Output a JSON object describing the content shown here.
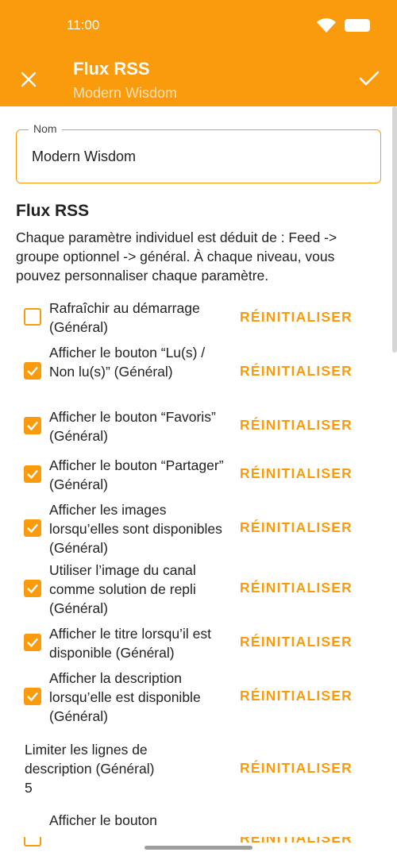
{
  "status": {
    "time": "11:00"
  },
  "header": {
    "title": "Flux RSS",
    "subtitle": "Modern Wisdom"
  },
  "name_field": {
    "label": "Nom",
    "value": "Modern Wisdom"
  },
  "section": {
    "title": "Flux RSS",
    "description": "Chaque paramètre individuel est déduit de : Feed -> groupe optionnel -> général. À chaque niveau, vous pouvez personnaliser chaque paramètre."
  },
  "settings": [
    {
      "label": "Rafraîchir au démarrage (Général)",
      "checked": false,
      "reset": "RÉINITIALISER"
    },
    {
      "label": "Afficher le bouton “Lu(s) / Non lu(s)” (Général)",
      "checked": true,
      "reset": "RÉINITIALISER"
    },
    {
      "label": "Afficher le bouton “Favoris” (Général)",
      "checked": true,
      "reset": "RÉINITIALISER"
    },
    {
      "label": "Afficher le bouton “Partager” (Général)",
      "checked": true,
      "reset": "RÉINITIALISER"
    },
    {
      "label": "Afficher les images lorsqu’elles sont disponibles (Général)",
      "checked": true,
      "reset": "RÉINITIALISER"
    },
    {
      "label": "Utiliser l’image du canal comme solution de repli (Général)",
      "checked": true,
      "reset": "RÉINITIALISER"
    },
    {
      "label": "Afficher le titre lorsqu’il est disponible (Général)",
      "checked": true,
      "reset": "RÉINITIALISER"
    },
    {
      "label": "Afficher la description lorsqu’elle est disponible (Général)",
      "checked": true,
      "reset": "RÉINITIALISER"
    },
    {
      "label": "Limiter les lignes de description (Général)",
      "value": "5",
      "reset": "RÉINITIALISER"
    },
    {
      "label": "Afficher le bouton",
      "checked": false,
      "reset": "RÉINITIALISER"
    }
  ],
  "colors": {
    "accent": "#f99b0d"
  }
}
